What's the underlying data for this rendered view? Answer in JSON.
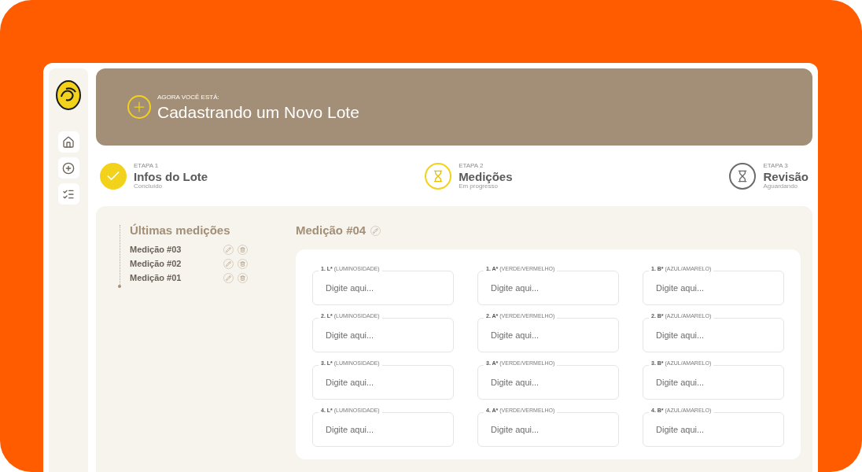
{
  "header": {
    "eyebrow": "AGORA VOCÊ ESTÁ:",
    "title": "Cadastrando um Novo Lote"
  },
  "sidebar": {
    "items": [
      {
        "kind": "home"
      },
      {
        "kind": "add"
      },
      {
        "kind": "list"
      }
    ]
  },
  "steps": [
    {
      "step": "ETAPA 1",
      "title": "Infos do Lote",
      "status": "Concluído",
      "kind": "done"
    },
    {
      "step": "ETAPA 2",
      "title": "Medições",
      "status": "Em progresso",
      "kind": "progress"
    },
    {
      "step": "ETAPA 3",
      "title": "Revisão",
      "status": "Aguardando",
      "kind": "waiting"
    }
  ],
  "history": {
    "title": "Últimas medições",
    "items": [
      "Medição #03",
      "Medição #02",
      "Medição #01"
    ]
  },
  "form": {
    "title": "Medição #04",
    "rows": [
      [
        {
          "label": "1. L*",
          "hint": "(LUMINOSIDADE)",
          "placeholder": "Digite aqui..."
        },
        {
          "label": "1. A*",
          "hint": "(VERDE/VERMELHO)",
          "placeholder": "Digite aqui..."
        },
        {
          "label": "1. B*",
          "hint": "(AZUL/AMARELO)",
          "placeholder": "Digite aqui..."
        }
      ],
      [
        {
          "label": "2. L*",
          "hint": "(LUMINOSIDADE)",
          "placeholder": "Digite aqui..."
        },
        {
          "label": "2. A*",
          "hint": "(VERDE/VERMELHO)",
          "placeholder": "Digite aqui..."
        },
        {
          "label": "2. B*",
          "hint": "(AZUL/AMARELO)",
          "placeholder": "Digite aqui..."
        }
      ],
      [
        {
          "label": "3. L*",
          "hint": "(LUMINOSIDADE)",
          "placeholder": "Digite aqui..."
        },
        {
          "label": "3. A*",
          "hint": "(VERDE/VERMELHO)",
          "placeholder": "Digite aqui..."
        },
        {
          "label": "3. B*",
          "hint": "(AZUL/AMARELO)",
          "placeholder": "Digite aqui..."
        }
      ],
      [
        {
          "label": "4. L*",
          "hint": "(LUMINOSIDADE)",
          "placeholder": "Digite aqui..."
        },
        {
          "label": "4. A*",
          "hint": "(VERDE/VERMELHO)",
          "placeholder": "Digite aqui..."
        },
        {
          "label": "4. B*",
          "hint": "(AZUL/AMARELO)",
          "placeholder": "Digite aqui..."
        }
      ]
    ]
  }
}
